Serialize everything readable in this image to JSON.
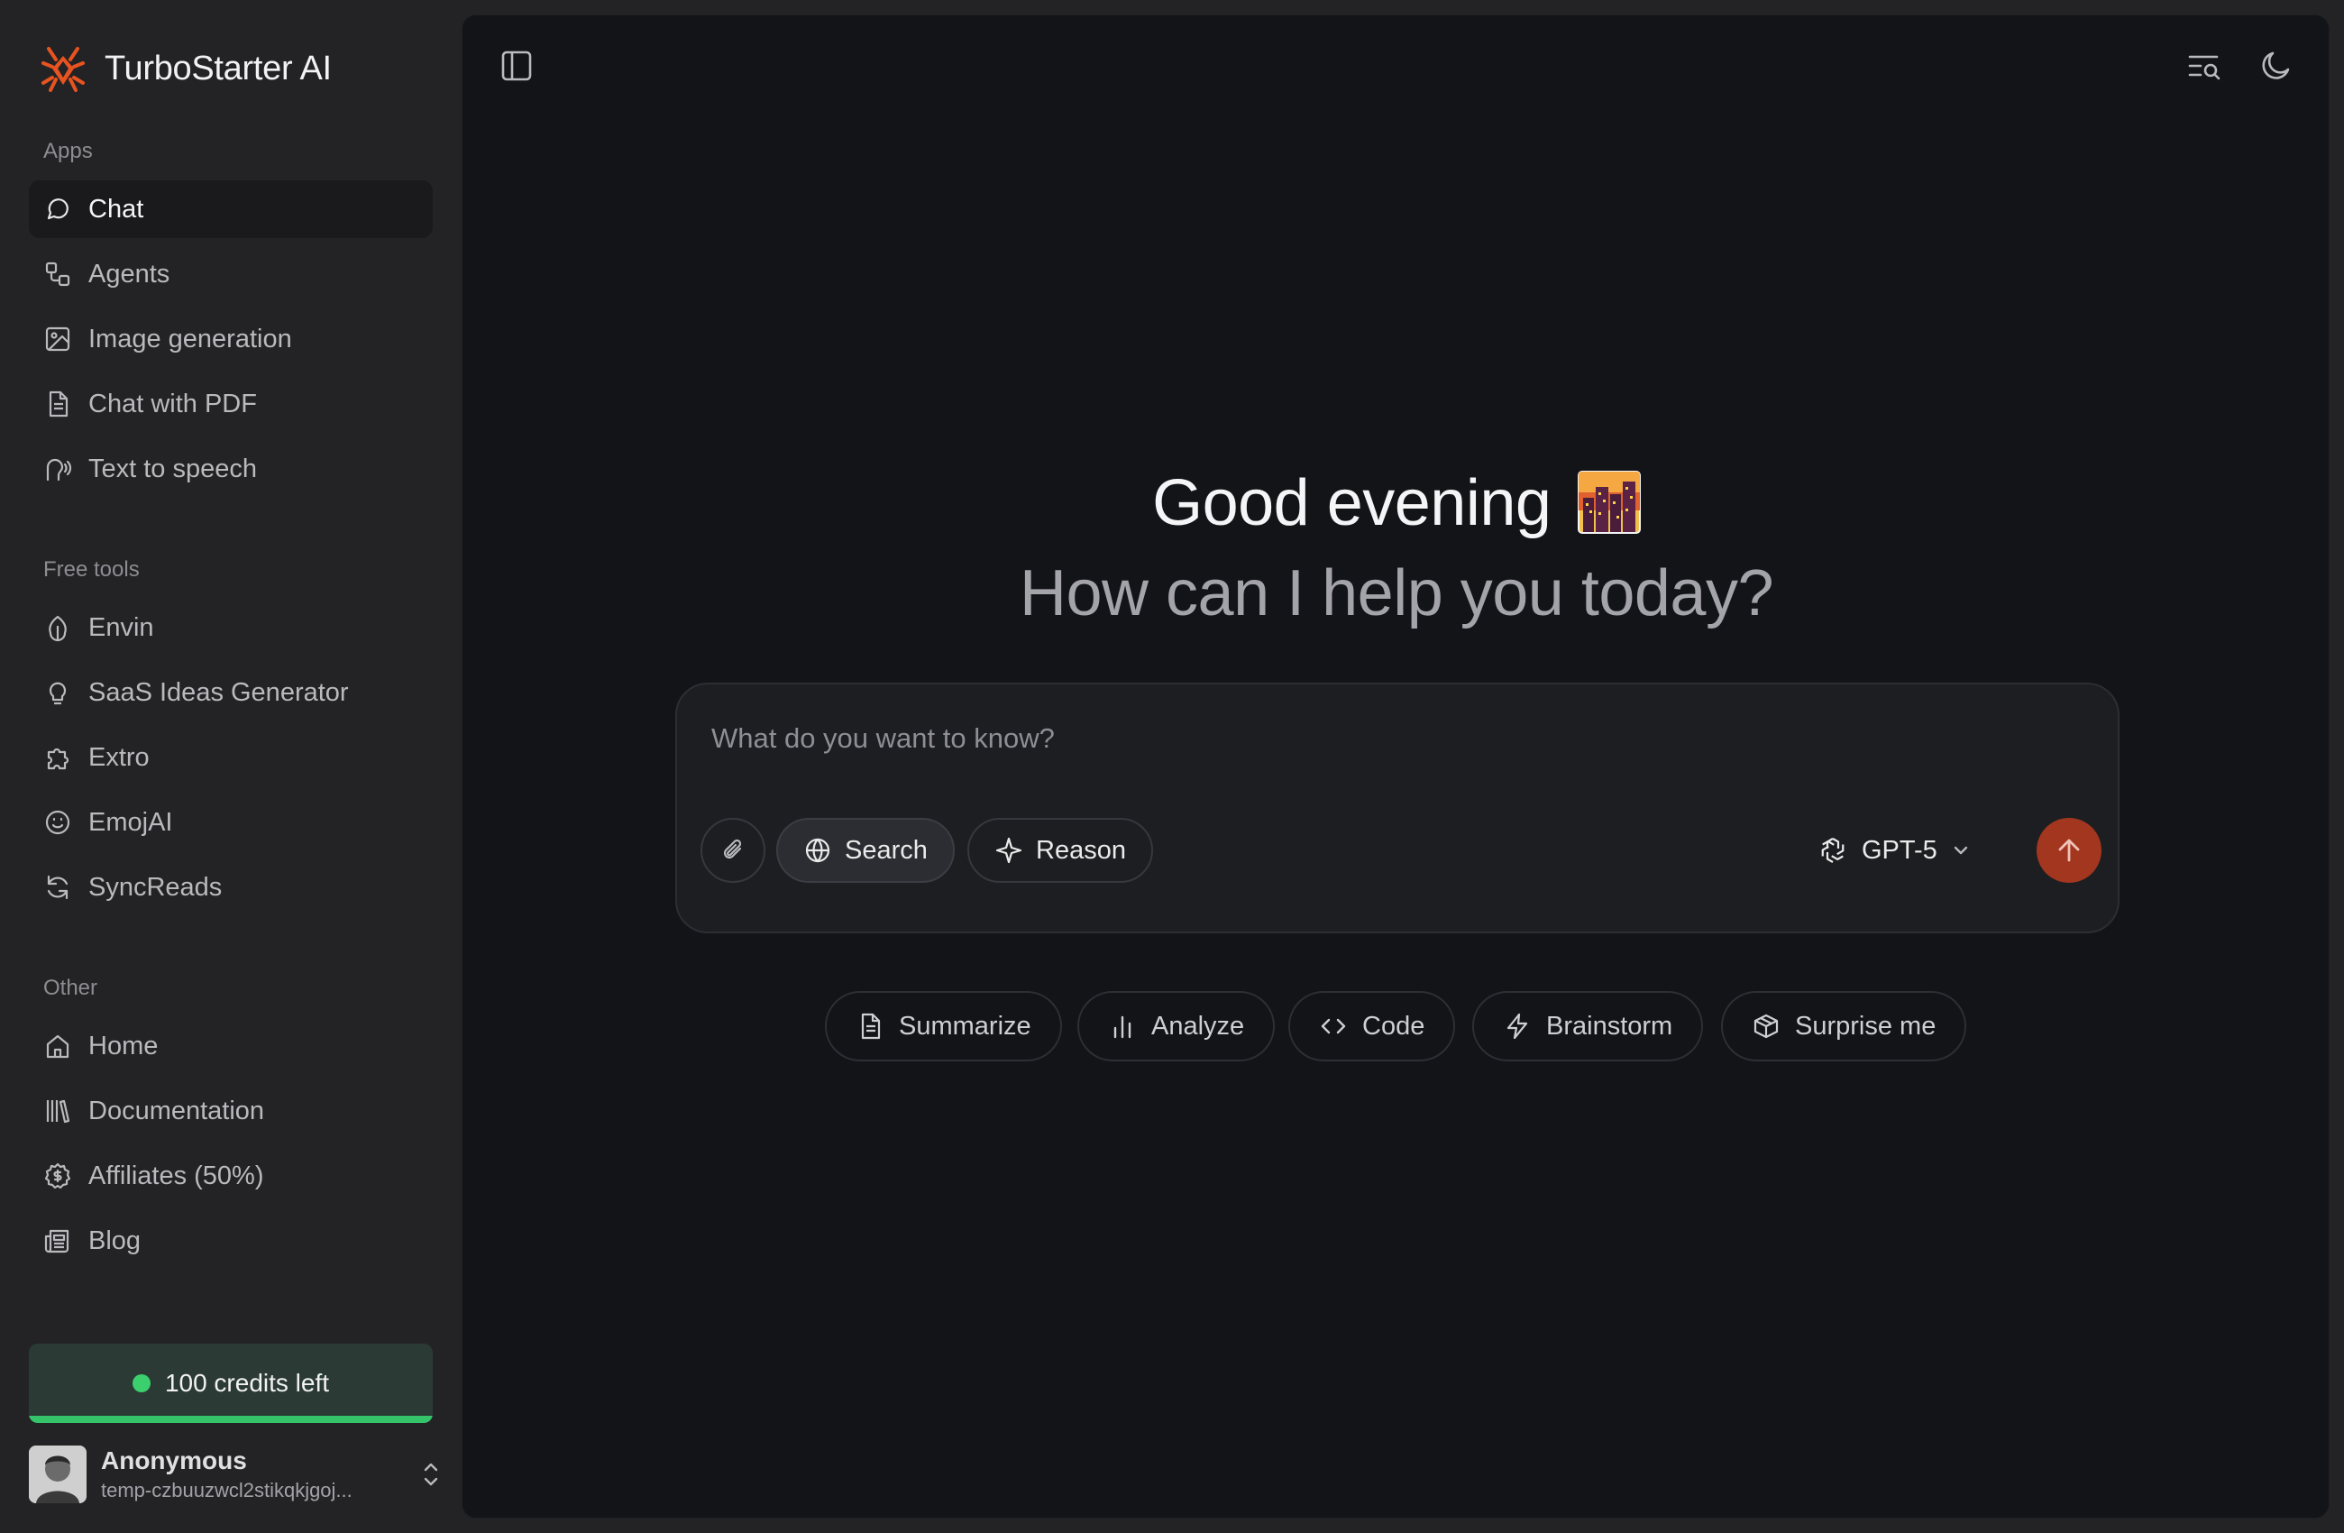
{
  "app": {
    "name": "TurboStarter AI"
  },
  "sidebar": {
    "sections": {
      "apps": "Apps",
      "free_tools": "Free tools",
      "other": "Other"
    },
    "apps": [
      {
        "label": "Chat",
        "icon": "chat-bubble-icon",
        "active": true
      },
      {
        "label": "Agents",
        "icon": "workflow-icon"
      },
      {
        "label": "Image generation",
        "icon": "image-icon"
      },
      {
        "label": "Chat with PDF",
        "icon": "document-icon"
      },
      {
        "label": "Text to speech",
        "icon": "speech-icon"
      }
    ],
    "free_tools": [
      {
        "label": "Envin",
        "icon": "leaf-icon"
      },
      {
        "label": "SaaS Ideas Generator",
        "icon": "lightbulb-icon"
      },
      {
        "label": "Extro",
        "icon": "puzzle-icon"
      },
      {
        "label": "EmojAI",
        "icon": "smile-icon"
      },
      {
        "label": "SyncReads",
        "icon": "refresh-icon"
      }
    ],
    "other": [
      {
        "label": "Home",
        "icon": "home-icon"
      },
      {
        "label": "Documentation",
        "icon": "library-icon"
      },
      {
        "label": "Affiliates (50%)",
        "icon": "dollar-badge-icon"
      },
      {
        "label": "Blog",
        "icon": "newspaper-icon"
      }
    ],
    "credits": {
      "label": "100 credits left",
      "remaining_fraction": 1.0,
      "color": "#36c46a"
    },
    "user": {
      "name": "Anonymous",
      "email": "temp-czbuuzwcl2stikqkjgoj..."
    }
  },
  "main": {
    "greeting": "Good evening",
    "greeting_emoji": "cityscape-at-dusk",
    "subgreeting": "How can I help you today?",
    "composer": {
      "placeholder": "What do you want to know?",
      "value": "",
      "search_label": "Search",
      "reason_label": "Reason",
      "model": "GPT-5"
    },
    "suggestions": [
      {
        "label": "Summarize",
        "icon": "file-text-icon"
      },
      {
        "label": "Analyze",
        "icon": "bar-chart-icon"
      },
      {
        "label": "Code",
        "icon": "code-icon"
      },
      {
        "label": "Brainstorm",
        "icon": "lightning-icon"
      },
      {
        "label": "Surprise me",
        "icon": "box-icon"
      }
    ]
  },
  "colors": {
    "accent": "#a3361f",
    "brand_logo": "#e8531f",
    "credits_green": "#36c46a"
  }
}
